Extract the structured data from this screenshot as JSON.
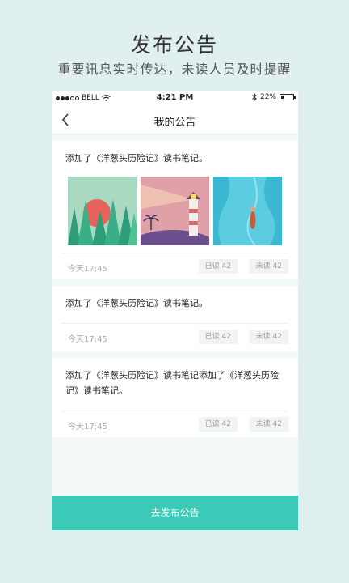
{
  "promo": {
    "title": "发布公告",
    "subtitle": "重要讯息实时传达，未读人员及时提醒"
  },
  "status_bar": {
    "carrier": "BELL",
    "time": "4:21 PM",
    "battery_text": "22%",
    "battery_level": 0.22,
    "signal_bars": 3,
    "icons": [
      "wifi-icon",
      "bluetooth-icon",
      "battery-icon"
    ]
  },
  "nav": {
    "title": "我的公告",
    "back_icon": "chevron-left-icon"
  },
  "announcements": [
    {
      "text": "添加了《洋葱头历险记》读书笔记。",
      "time": "今天17:45",
      "read": "已读 42",
      "unread": "未读 42",
      "images": [
        "forest-sunset-illustration",
        "lighthouse-illustration",
        "ocean-diver-illustration"
      ]
    },
    {
      "text": "添加了《洋葱头历险记》读书笔记。",
      "time": "今天17:45",
      "read": "已读 42",
      "unread": "未读 42"
    },
    {
      "text": "添加了《洋葱头历险记》读书笔记添加了《洋葱头历险记》读书笔记。",
      "time": "今天17:45",
      "read": "已读 42",
      "unread": "未读 42"
    }
  ],
  "publish_button": "去发布公告",
  "colors": {
    "accent": "#3ccab8",
    "background": "#dff0ef"
  }
}
